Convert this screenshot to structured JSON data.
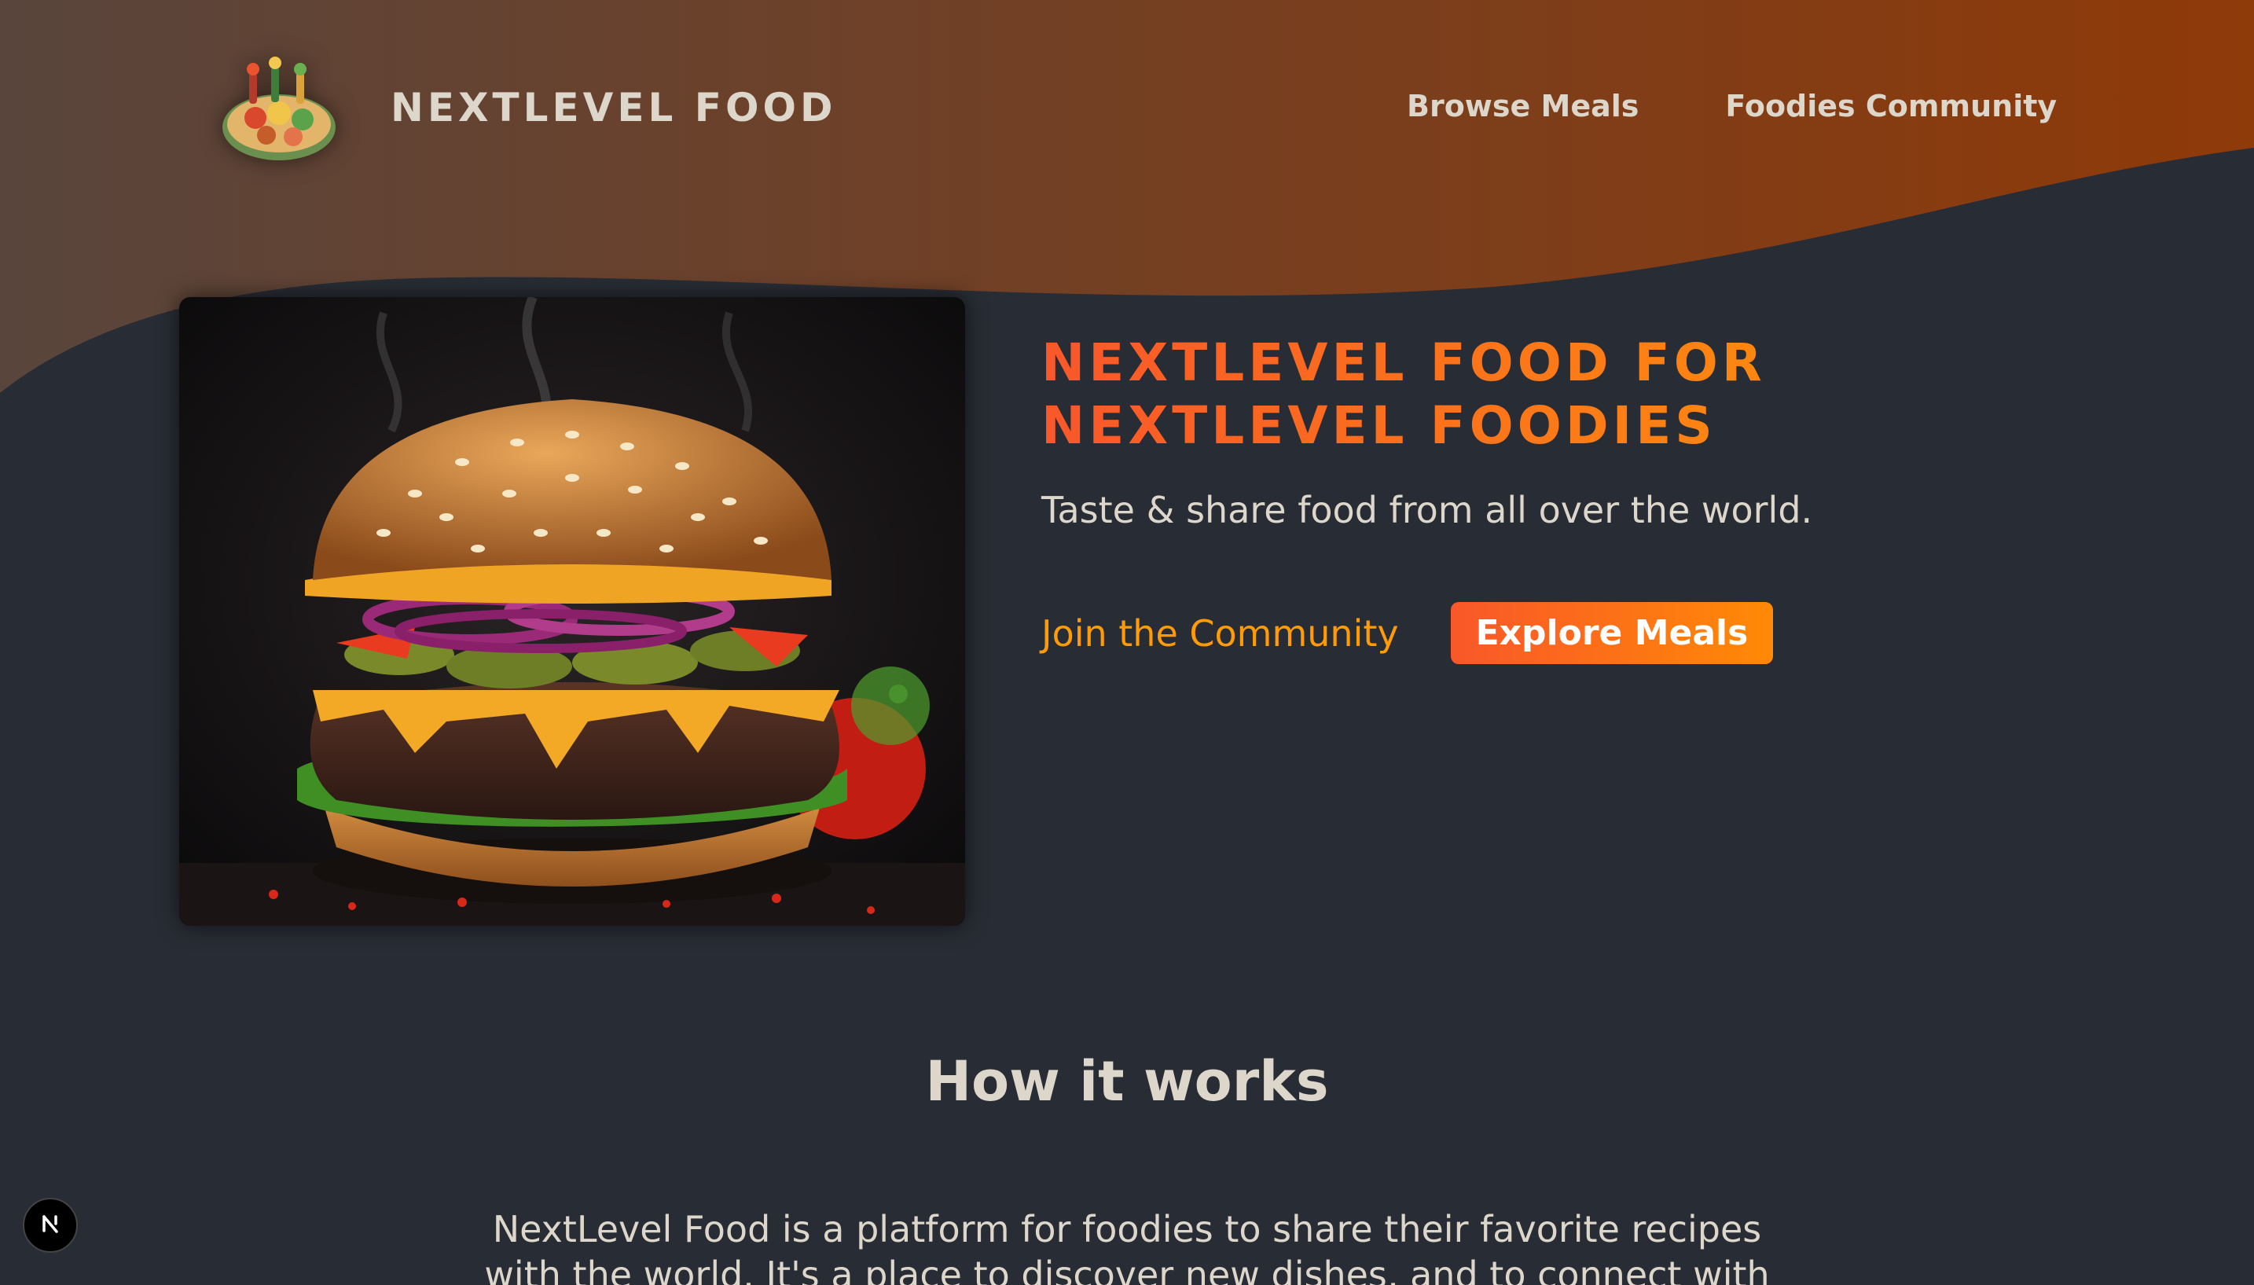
{
  "header": {
    "logo_text": "NextLevel Food",
    "logo_icon": "food-platter-icon",
    "nav": [
      {
        "label": "Browse Meals"
      },
      {
        "label": "Foodies Community"
      }
    ],
    "gradient": [
      "#59453c",
      "#8f3a09"
    ]
  },
  "hero": {
    "image_icon": "burger-image",
    "title": "NextLevel Food for NextLevel Foodies",
    "subtitle": "Taste & share food from all over the world.",
    "community_link": "Join the Community",
    "explore_button": "Explore Meals"
  },
  "how_it_works": {
    "title": "How it works",
    "text": "NextLevel Food is a platform for foodies to share their favorite recipes with the world. It's a place to discover new dishes, and to connect with"
  },
  "dev_badge": {
    "icon": "nextjs-icon"
  },
  "colors": {
    "background": "#282c34",
    "text": "#ddd6cb",
    "accent_start": "#f9572a",
    "accent_end": "#ff9b05"
  }
}
